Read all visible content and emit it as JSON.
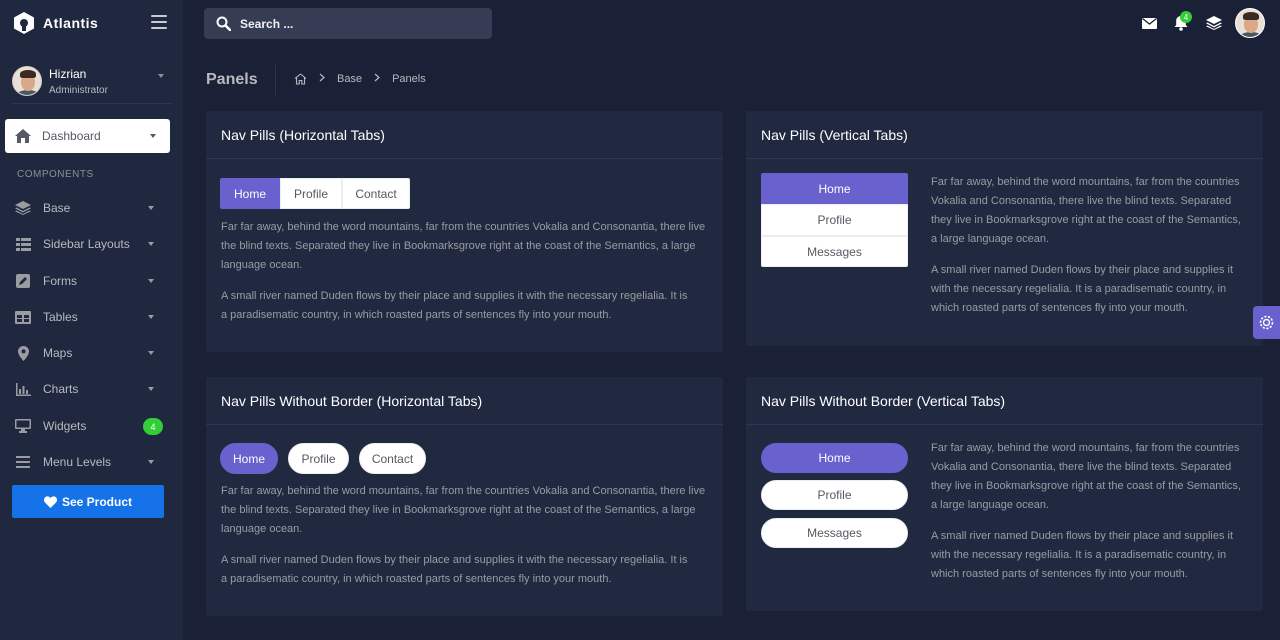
{
  "brand": {
    "name": "Atlantis"
  },
  "user": {
    "name": "Hizrian",
    "role": "Administrator"
  },
  "sidebar": {
    "dashboard": "Dashboard",
    "section": "COMPONENTS",
    "items": [
      {
        "label": "Base",
        "icon": "layers-icon"
      },
      {
        "label": "Sidebar Layouts",
        "icon": "th-list-icon"
      },
      {
        "label": "Forms",
        "icon": "pen-square-icon"
      },
      {
        "label": "Tables",
        "icon": "table-icon"
      },
      {
        "label": "Maps",
        "icon": "map-marker-icon"
      },
      {
        "label": "Charts",
        "icon": "bar-chart-icon"
      },
      {
        "label": "Widgets",
        "icon": "desktop-icon",
        "badge": "4"
      },
      {
        "label": "Menu Levels",
        "icon": "bars-icon"
      }
    ],
    "see_product": "See Product"
  },
  "topbar": {
    "search_placeholder": "Search ...",
    "notifications": "4"
  },
  "page": {
    "title": "Panels",
    "breadcrumb": [
      "Base",
      "Panels"
    ]
  },
  "cards": {
    "c1": {
      "title": "Nav Pills (Horizontal Tabs)",
      "pills": [
        "Home",
        "Profile",
        "Contact"
      ]
    },
    "c2": {
      "title": "Nav Pills (Vertical Tabs)",
      "pills": [
        "Home",
        "Profile",
        "Messages"
      ]
    },
    "c3": {
      "title": "Nav Pills Without Border (Horizontal Tabs)",
      "pills": [
        "Home",
        "Profile",
        "Contact"
      ]
    },
    "c4": {
      "title": "Nav Pills Without Border (Vertical Tabs)",
      "pills": [
        "Home",
        "Profile",
        "Messages"
      ]
    }
  },
  "text": {
    "p1": "Far far away, behind the word mountains, far from the countries Vokalia and Consonantia, there live the blind texts. Separated they live in Bookmarksgrove right at the coast of the Semantics, a large language ocean.",
    "p2": "A small river named Duden flows by their place and supplies it with the necessary regelialia. It is a paradisematic country, in which roasted parts of sentences fly into your mouth."
  },
  "colors": {
    "accent": "#6861ce",
    "primary": "#1572e8",
    "success": "#31ce36",
    "bg": "#1a2035",
    "card": "#202940"
  }
}
